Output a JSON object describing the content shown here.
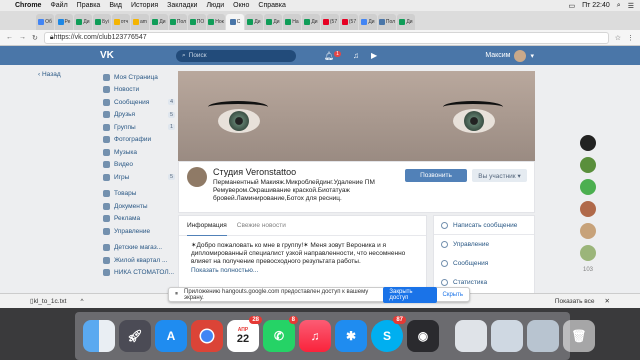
{
  "menubar": {
    "app": "Chrome",
    "items": [
      "Файл",
      "Правка",
      "Вид",
      "История",
      "Закладки",
      "Люди",
      "Окно",
      "Справка"
    ],
    "clock": "Пт 22:40"
  },
  "tabs": [
    {
      "label": "Об",
      "color": "#4285f4"
    },
    {
      "label": "Ре",
      "color": "#1e88e5"
    },
    {
      "label": "Ди",
      "color": "#0f9d58"
    },
    {
      "label": "Буі",
      "color": "#0f9d58"
    },
    {
      "label": "отч",
      "color": "#f4b400"
    },
    {
      "label": "am",
      "color": "#f4b400"
    },
    {
      "label": "Ди",
      "color": "#0f9d58"
    },
    {
      "label": "Пол",
      "color": "#0f9d58"
    },
    {
      "label": "ПО",
      "color": "#0f9d58"
    },
    {
      "label": "Нок",
      "color": "#0f9d58"
    },
    {
      "label": "С",
      "color": "#4a76a8"
    },
    {
      "label": "Ди",
      "color": "#0f9d58"
    },
    {
      "label": "Ди",
      "color": "#0f9d58"
    },
    {
      "label": "На",
      "color": "#0f9d58"
    },
    {
      "label": "Ди",
      "color": "#0f9d58"
    },
    {
      "label": "(57",
      "color": "#e60023"
    },
    {
      "label": "(57",
      "color": "#e60023"
    },
    {
      "label": "Ди",
      "color": "#4285f4"
    },
    {
      "label": "Пол",
      "color": "#4a76a8"
    },
    {
      "label": "Ди",
      "color": "#0f9d58"
    }
  ],
  "address": {
    "url": "https://vk.com/club123776547"
  },
  "vk": {
    "logo": "VK",
    "search_placeholder": "Поиск",
    "notif_count": "1",
    "user_name": "Максим",
    "back": "Назад",
    "nav": [
      {
        "label": "Моя Страница",
        "count": ""
      },
      {
        "label": "Новости",
        "count": ""
      },
      {
        "label": "Сообщения",
        "count": "4"
      },
      {
        "label": "Друзья",
        "count": "5"
      },
      {
        "label": "Группы",
        "count": "1"
      },
      {
        "label": "Фотографии",
        "count": ""
      },
      {
        "label": "Музыка",
        "count": ""
      },
      {
        "label": "Видео",
        "count": ""
      },
      {
        "label": "Игры",
        "count": "5"
      }
    ],
    "nav2": [
      {
        "label": "Товары"
      },
      {
        "label": "Документы"
      },
      {
        "label": "Реклама"
      },
      {
        "label": "Управление"
      }
    ],
    "nav3": [
      {
        "label": "Детские магаз..."
      },
      {
        "label": "Жилой квартал ..."
      },
      {
        "label": "НИКА СТОМАТОЛ..."
      }
    ],
    "group_name": "Студия Veronstattoo",
    "description": "Перманентный Макияж.Микроблейдинг.Удаление ПМ Ремувером.Окрашивание краской.Биотатуаж бровей.Ламинирование,Ботох для ресниц.",
    "btn_message": "Позвонить",
    "btn_member": "Вы участник ▾",
    "info_tabs": [
      "Информация",
      "Свежие новости"
    ],
    "info_text": "✶Добро пожаловать ко мне в группу!✶ Меня зовут Вероника и я дипломированный специалист узкой направленности, что несомненно влияет на получение превосходного результата работы.",
    "info_more": "Показать полностью...",
    "right_items": [
      "Написать сообщение",
      "Управление",
      "Сообщения",
      "Статистика"
    ],
    "chats_count": "103"
  },
  "notification": {
    "text": "Приложению hangouts.google.com предоставлен доступ к вашему экрану.",
    "share": "Закрыть доступ",
    "hide": "Скрыть"
  },
  "download": {
    "file": "kl_to_1c.txt",
    "show_all": "Показать все"
  },
  "dock": {
    "calendar_month": "АПР",
    "calendar_day": "22",
    "badge_cal": "28",
    "badge_whatsapp": "8",
    "badge_skype": "87"
  }
}
